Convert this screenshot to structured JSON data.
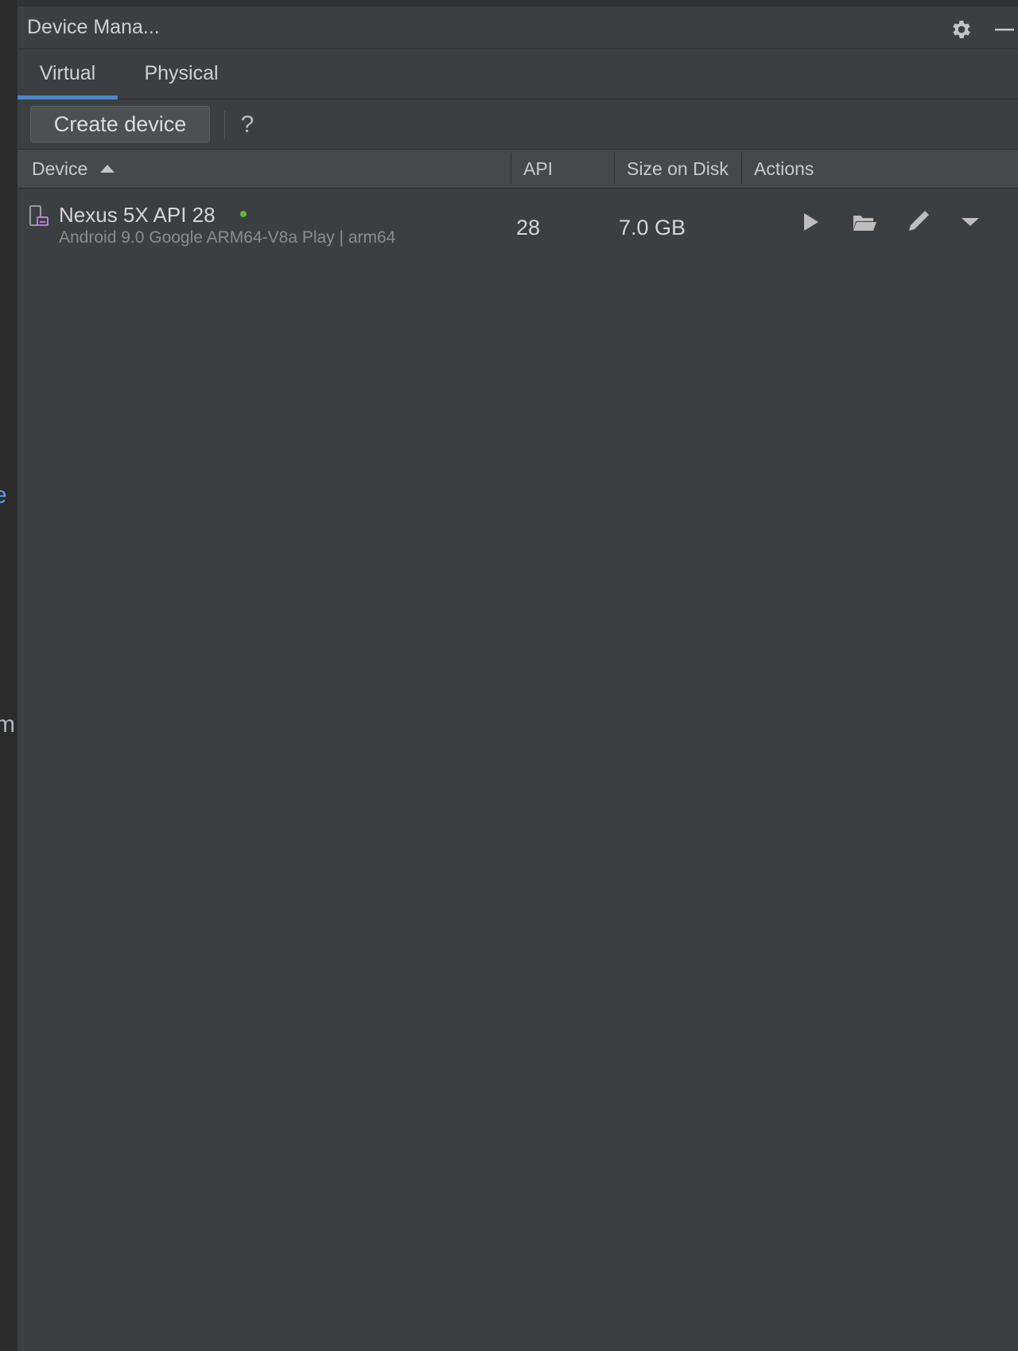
{
  "window": {
    "title": "Device Mana..."
  },
  "editor_fragments": {
    "blue": "e",
    "gray": "m"
  },
  "tabs": [
    {
      "label": "Virtual",
      "active": true
    },
    {
      "label": "Physical",
      "active": false
    }
  ],
  "toolbar": {
    "create_label": "Create device",
    "help_label": "?"
  },
  "table": {
    "columns": {
      "device": "Device",
      "api": "API",
      "size": "Size on Disk",
      "actions": "Actions"
    },
    "sort": {
      "column": "Device",
      "direction": "ascending"
    },
    "rows": [
      {
        "name": "Nexus 5X API 28",
        "details": "Android 9.0 Google ARM64-V8a Play | arm64",
        "api": "28",
        "size": "7.0 GB",
        "status": "online",
        "status_color": "#5fb832",
        "actions": [
          "play-icon",
          "folder-icon",
          "pencil-icon",
          "chevron-down-icon"
        ]
      }
    ]
  },
  "colors": {
    "accent": "#4a88c7",
    "background": "#3c3f41",
    "header": "#45494a"
  }
}
